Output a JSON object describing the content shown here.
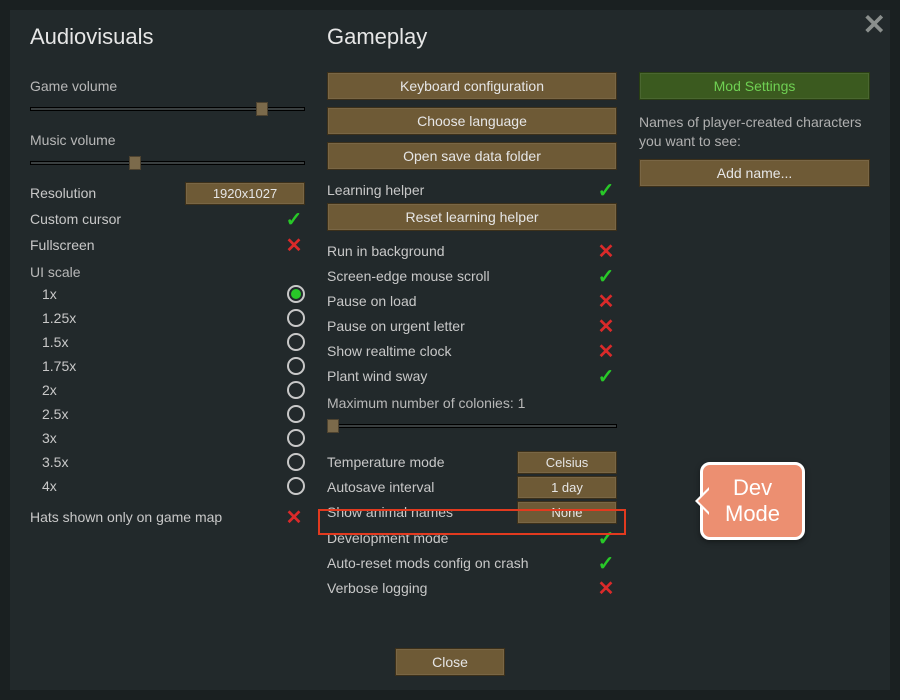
{
  "audiovisuals": {
    "title": "Audiovisuals",
    "game_volume_label": "Game volume",
    "game_volume_pct": 82,
    "music_volume_label": "Music volume",
    "music_volume_pct": 36,
    "resolution_label": "Resolution",
    "resolution_value": "1920x1027",
    "custom_cursor_label": "Custom cursor",
    "custom_cursor_on": true,
    "fullscreen_label": "Fullscreen",
    "fullscreen_on": false,
    "ui_scale_label": "UI scale",
    "ui_scale_options": [
      "1x",
      "1.25x",
      "1.5x",
      "1.75x",
      "2x",
      "2.5x",
      "3x",
      "3.5x",
      "4x"
    ],
    "ui_scale_selected": "1x",
    "hats_label": "Hats shown only on game map",
    "hats_on": false
  },
  "gameplay": {
    "title": "Gameplay",
    "keyboard_btn": "Keyboard configuration",
    "language_btn": "Choose language",
    "save_folder_btn": "Open save data folder",
    "learning_helper_label": "Learning helper",
    "learning_helper_on": true,
    "reset_learning_btn": "Reset learning helper",
    "toggles": [
      {
        "label": "Run in background",
        "on": false
      },
      {
        "label": "Screen-edge mouse scroll",
        "on": true
      },
      {
        "label": "Pause on load",
        "on": false
      },
      {
        "label": "Pause on urgent letter",
        "on": false
      },
      {
        "label": "Show realtime clock",
        "on": false
      },
      {
        "label": "Plant wind sway",
        "on": true
      }
    ],
    "max_colonies_label": "Maximum number of colonies: 1",
    "max_colonies_pct": 0,
    "selects": [
      {
        "label": "Temperature mode",
        "value": "Celsius"
      },
      {
        "label": "Autosave interval",
        "value": "1 day"
      },
      {
        "label": "Show animal names",
        "value": "None"
      }
    ],
    "toggles2": [
      {
        "label": "Development mode",
        "on": true
      },
      {
        "label": "Auto-reset mods config on crash",
        "on": true
      },
      {
        "label": "Verbose logging",
        "on": false
      }
    ]
  },
  "mods": {
    "settings_btn": "Mod Settings",
    "desc": "Names of player-created characters you want to see:",
    "add_name_btn": "Add name..."
  },
  "close_btn": "Close",
  "callout": {
    "line1": "Dev",
    "line2": "Mode"
  }
}
